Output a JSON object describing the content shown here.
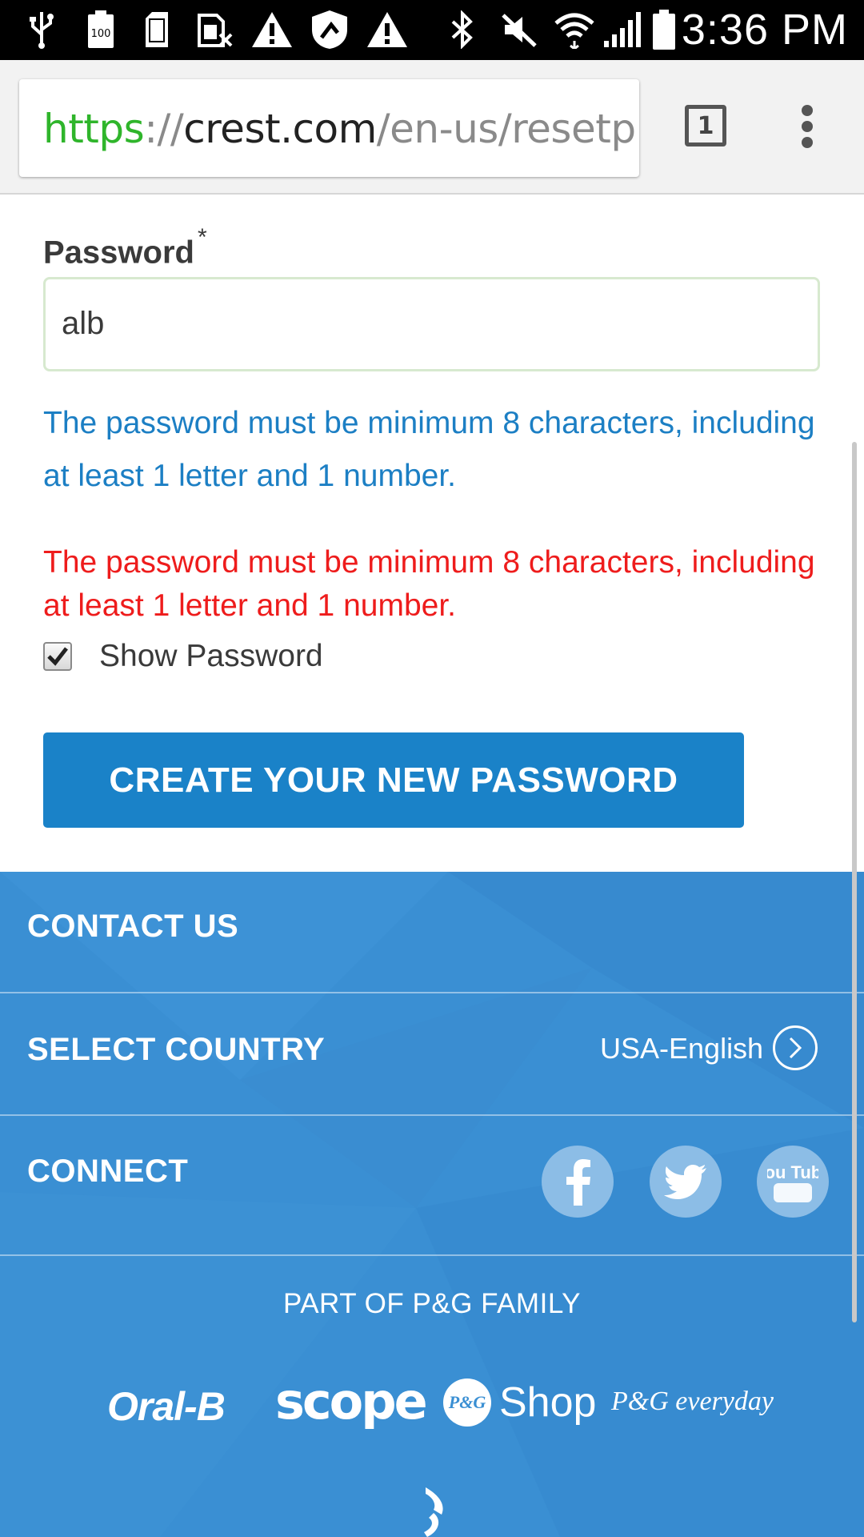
{
  "status_bar": {
    "time": "3:36 PM",
    "battery_notification_text": "100",
    "icons": [
      "usb-icon",
      "battery-100-icon",
      "sd-card-icon",
      "sim-off-icon",
      "warning-icon",
      "shield-update-icon",
      "warning-icon",
      "bluetooth-icon",
      "mute-icon",
      "wifi-icon",
      "signal-icon",
      "battery-icon"
    ]
  },
  "browser": {
    "url_scheme": "https",
    "url_separator": "://",
    "url_host": "crest.com",
    "url_path": "/en-us/resetp",
    "tab_count": "1"
  },
  "form": {
    "password_label": "Password",
    "required_marker": "*",
    "password_value": "alb",
    "hint_text": "The password must be minimum 8 characters, including at least 1 letter and 1 number.",
    "error_text": "The password must be minimum 8 characters, including at least 1 letter and 1 number.",
    "show_password_label": "Show Password",
    "show_password_checked": true,
    "submit_label": "CREATE YOUR NEW PASSWORD"
  },
  "footer": {
    "contact_label": "CONTACT US",
    "select_country_label": "SELECT COUNTRY",
    "country_value": "USA-English",
    "connect_label": "CONNECT",
    "social": [
      "facebook-icon",
      "twitter-icon",
      "youtube-icon"
    ],
    "youtube_text": "You Tube",
    "family_label": "PART OF P&G FAMILY",
    "brands": {
      "oralb": "Oral-B",
      "scope": "scope",
      "pg_badge": "P&G",
      "shop": "Shop",
      "everyday": "P&G everyday"
    }
  },
  "colors": {
    "accent_blue": "#1a82c8",
    "footer_blue": "#3a8fd3",
    "hint_blue": "#1c7fc4",
    "error_red": "#ee1c1c",
    "url_green": "#2fb52b"
  }
}
